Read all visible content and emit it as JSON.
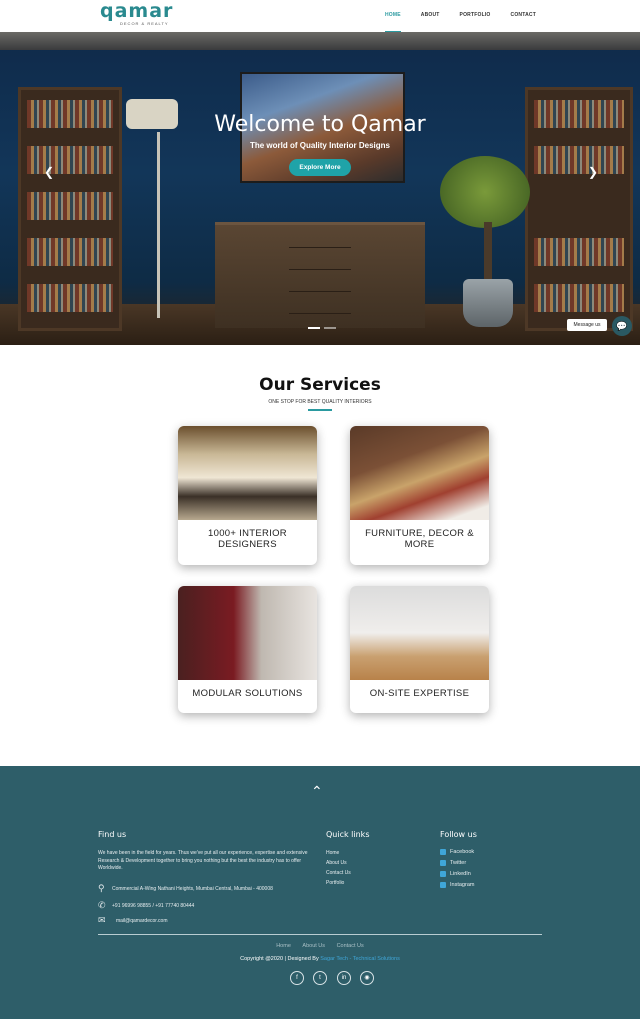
{
  "header": {
    "logo_text": "qamar",
    "logo_tagline": "DECOR & REALTY",
    "nav": [
      "HOME",
      "ABOUT",
      "PORTFOLIO",
      "CONTACT"
    ]
  },
  "hero": {
    "title": "Welcome to Qamar",
    "subtitle": "The world of Quality Interior Designs",
    "button": "Explore More",
    "prev_icon": "chevron-left",
    "next_icon": "chevron-right",
    "message_label": "Message us"
  },
  "services": {
    "title": "Our Services",
    "subtitle": "ONE STOP FOR BEST QUALITY INTERIORS",
    "cards": [
      {
        "label": "1000+ INTERIOR DESIGNERS"
      },
      {
        "label": "FURNITURE, DECOR & MORE"
      },
      {
        "label": "MODULAR SOLUTIONS"
      },
      {
        "label": "ON-SITE EXPERTISE"
      }
    ]
  },
  "footer": {
    "find_us": {
      "heading": "Find us",
      "text": "We have been in the field for years. Thus we've put all our experience, expertise and extensive Research & Development together to bring you nothing but the best the industry has to offer Worldwide.",
      "address": "Commercial A-Wing Nathani Heights, Mumbai Central, Mumbai - 400008",
      "phone": "+91 96996 98855 / +91 77740 80444",
      "email": "mail@qamardecor.com"
    },
    "quick_links": {
      "heading": "Quick links",
      "items": [
        "Home",
        "About Us",
        "Contact Us",
        "Portfolio"
      ]
    },
    "follow_us": {
      "heading": "Follow us",
      "items": [
        "Facebook",
        "Twitter",
        "LinkedIn",
        "Instagram"
      ]
    },
    "bottom_links": [
      "Home",
      "About Us",
      "Contact Us"
    ],
    "copyright": "Copyright @2020 | Designed By",
    "designer": "Sagar Tech - Technical Solutions",
    "social_icons": [
      "facebook-icon",
      "twitter-icon",
      "linkedin-icon",
      "instagram-icon"
    ]
  }
}
